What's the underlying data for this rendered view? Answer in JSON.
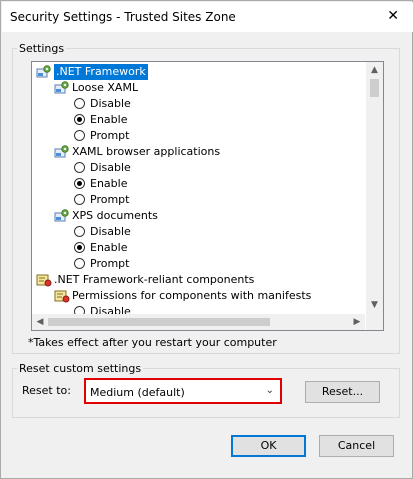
{
  "window": {
    "title": "Security Settings - Trusted Sites Zone",
    "close_symbol": "✕"
  },
  "settings": {
    "legend": "Settings",
    "tree": [
      {
        "type": "category",
        "icon": "gear-icon",
        "label": ".NET Framework",
        "selected": true
      },
      {
        "type": "category",
        "icon": "gear-icon",
        "label": "Loose XAML"
      },
      {
        "type": "option",
        "label": "Disable",
        "checked": false
      },
      {
        "type": "option",
        "label": "Enable",
        "checked": true
      },
      {
        "type": "option",
        "label": "Prompt",
        "checked": false
      },
      {
        "type": "category",
        "icon": "gear-icon",
        "label": "XAML browser applications"
      },
      {
        "type": "option",
        "label": "Disable",
        "checked": false
      },
      {
        "type": "option",
        "label": "Enable",
        "checked": true
      },
      {
        "type": "option",
        "label": "Prompt",
        "checked": false
      },
      {
        "type": "category",
        "icon": "gear-icon",
        "label": "XPS documents"
      },
      {
        "type": "option",
        "label": "Disable",
        "checked": false
      },
      {
        "type": "option",
        "label": "Enable",
        "checked": true
      },
      {
        "type": "option",
        "label": "Prompt",
        "checked": false
      },
      {
        "type": "category",
        "icon": "certificate-icon",
        "label": ".NET Framework-reliant components"
      },
      {
        "type": "category",
        "icon": "certificate-icon",
        "label": "Permissions for components with manifests"
      },
      {
        "type": "option",
        "label": "Disable",
        "checked": false
      }
    ],
    "note": "*Takes effect after you restart your computer"
  },
  "reset": {
    "legend": "Reset custom settings",
    "label": "Reset to:",
    "selected_value": "Medium (default)",
    "reset_button": "Reset..."
  },
  "footer": {
    "ok": "OK",
    "cancel": "Cancel"
  }
}
